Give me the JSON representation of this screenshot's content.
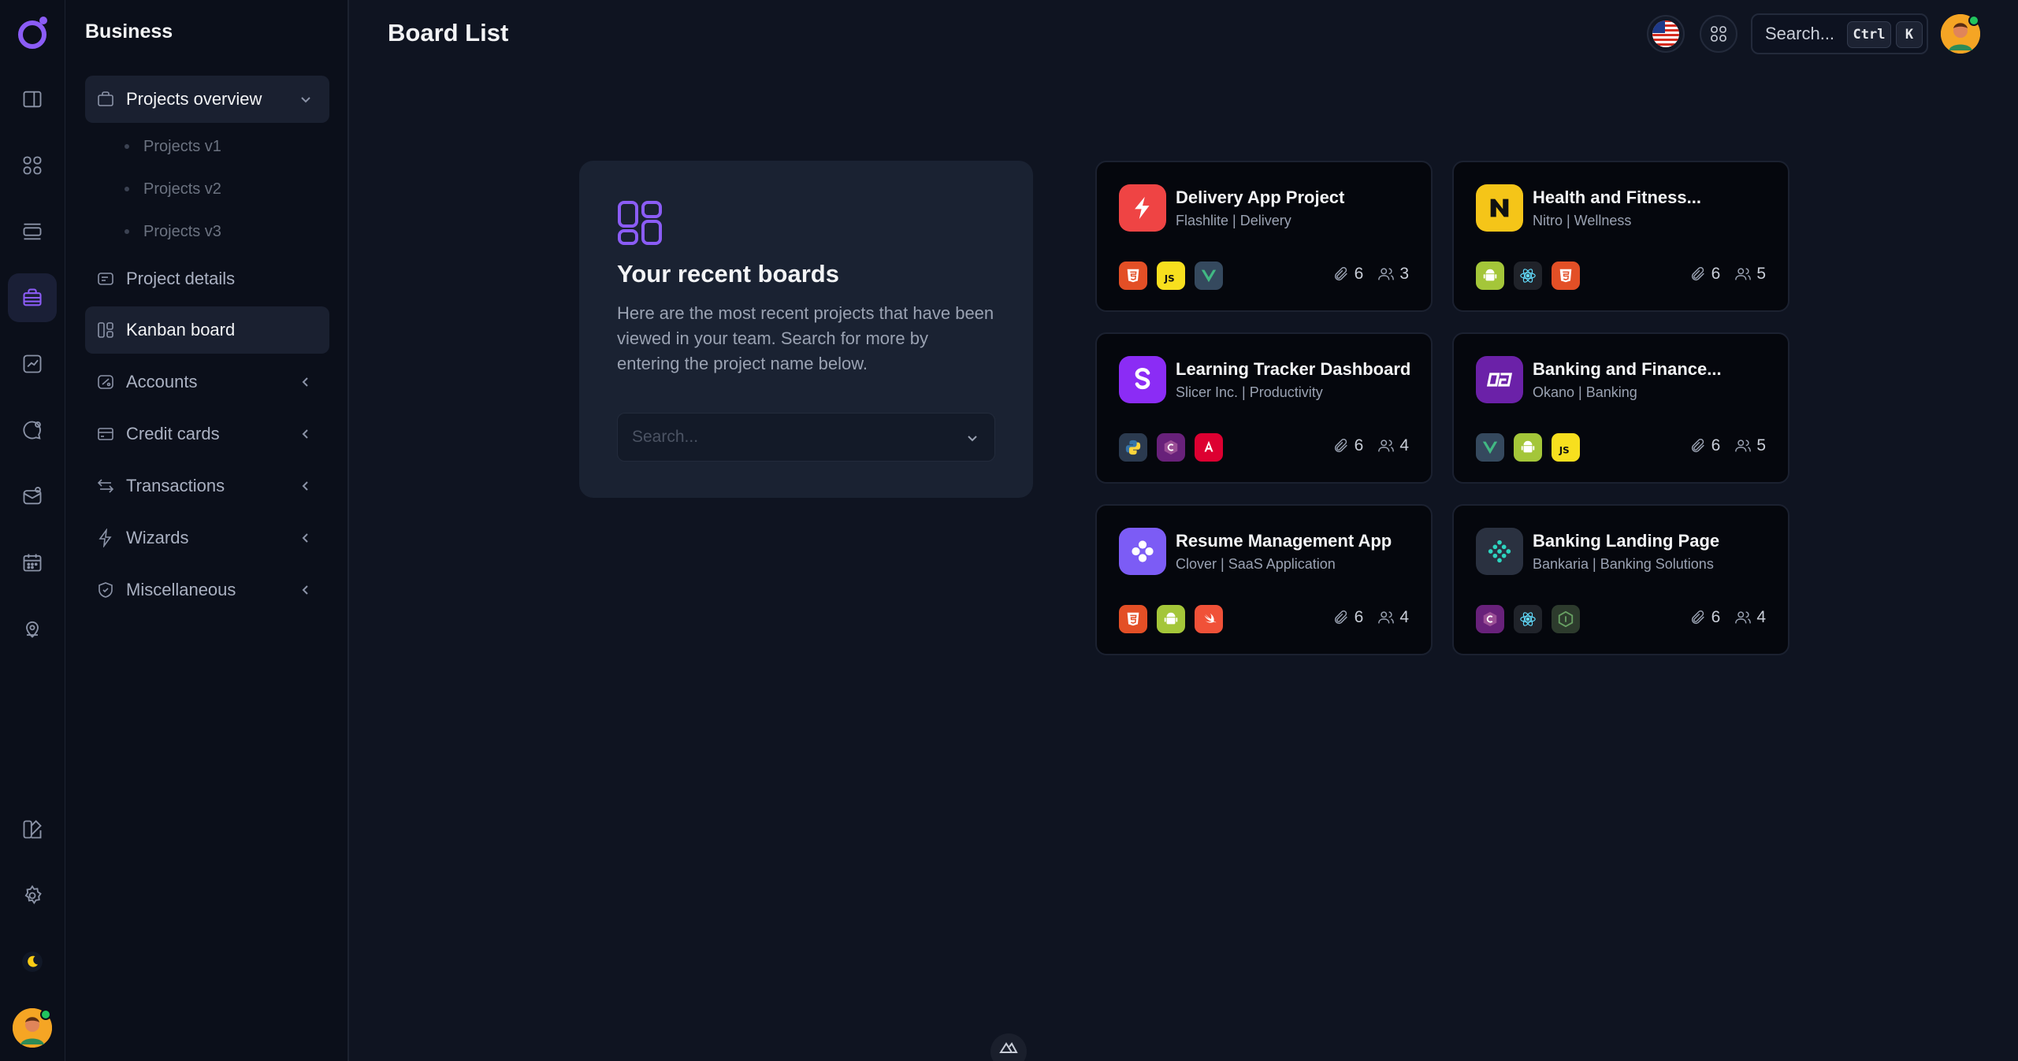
{
  "app": {
    "workspace": "Business",
    "page_title": "Board List",
    "accent_color": "#8b5cf6"
  },
  "rail": {
    "icons": [
      "logo-icon",
      "layout-panel-icon",
      "grid-icon",
      "list-icon",
      "briefcase-icon",
      "chart-icon",
      "chat-icon",
      "mail-icon",
      "calendar-icon",
      "map-pin-icon",
      "brush-icon",
      "settings-icon",
      "moon-icon",
      "avatar"
    ],
    "active": "briefcase-icon"
  },
  "sidebar": {
    "items": [
      {
        "label": "Projects overview",
        "icon": "briefcase-icon",
        "expanded": true
      },
      {
        "label": "Projects v1"
      },
      {
        "label": "Projects v2"
      },
      {
        "label": "Projects v3"
      },
      {
        "label": "Project details",
        "icon": "card-icon"
      },
      {
        "label": "Kanban board",
        "icon": "kanban-icon",
        "selected": true
      },
      {
        "label": "Accounts",
        "icon": "wallet-icon"
      },
      {
        "label": "Credit cards",
        "icon": "credit-card-icon"
      },
      {
        "label": "Transactions",
        "icon": "arrows-icon"
      },
      {
        "label": "Wizards",
        "icon": "bolt-icon"
      },
      {
        "label": "Miscellaneous",
        "icon": "shield-icon"
      }
    ]
  },
  "topbar": {
    "search_placeholder": "Search...",
    "shortcut_ctrl": "Ctrl",
    "shortcut_key": "K"
  },
  "recent": {
    "title": "Your recent boards",
    "description": "Here are the most recent projects that have been viewed in your team. Search for more by entering the project name below.",
    "search_placeholder": "Search..."
  },
  "projects": [
    {
      "title": "Delivery App Project",
      "subtitle": "Flashlite | Delivery",
      "logo": "bolt-icon",
      "logo_color": "#ef4444",
      "techs": [
        "html5",
        "javascript",
        "vue"
      ],
      "attachments": "6",
      "members": "3"
    },
    {
      "title": "Health and Fitness...",
      "subtitle": "Nitro | Wellness",
      "logo": "n-icon",
      "logo_color": "#f5c518",
      "techs": [
        "android",
        "react",
        "html5"
      ],
      "attachments": "6",
      "members": "5"
    },
    {
      "title": "Learning Tracker Dashboard",
      "subtitle": "Slicer Inc. | Productivity",
      "logo": "s-icon",
      "logo_color": "#8b2cf5",
      "techs": [
        "python",
        "csharp",
        "angular"
      ],
      "attachments": "6",
      "members": "4"
    },
    {
      "title": "Banking and Finance...",
      "subtitle": "Okano | Banking",
      "logo": "okano-icon",
      "logo_color": "#6b21a8",
      "techs": [
        "vue",
        "android",
        "javascript"
      ],
      "attachments": "6",
      "members": "5"
    },
    {
      "title": "Resume Management App",
      "subtitle": "Clover | SaaS Application",
      "logo": "clover-icon",
      "logo_color": "#7c5cf5",
      "techs": [
        "html5",
        "android",
        "swift"
      ],
      "attachments": "6",
      "members": "4"
    },
    {
      "title": "Banking Landing Page",
      "subtitle": "Bankaria | Banking Solutions",
      "logo": "bankaria-icon",
      "logo_color": "#2a3140",
      "techs": [
        "csharp",
        "react",
        "nodejs"
      ],
      "attachments": "6",
      "members": "4"
    }
  ]
}
